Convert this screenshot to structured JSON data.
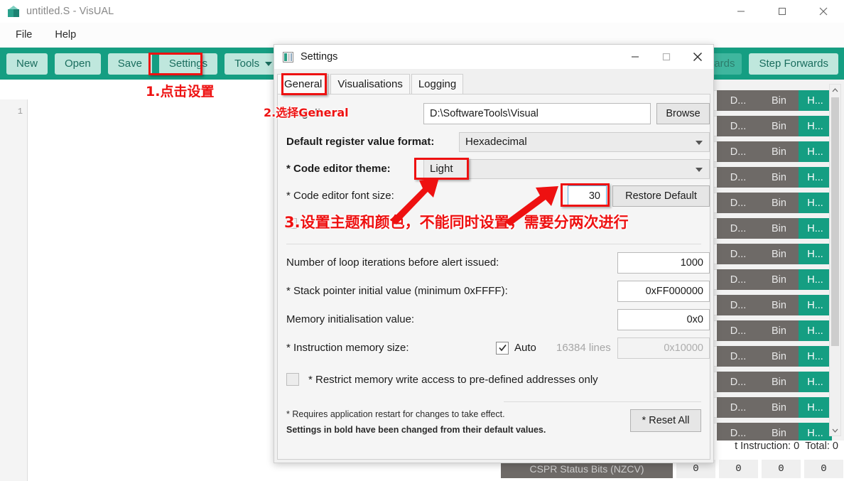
{
  "window": {
    "title": "untitled.S - VisUAL",
    "icon": "cube-icon",
    "controls": {
      "minimize": "minimize-icon",
      "maximize": "maximize-icon",
      "close": "close-icon"
    }
  },
  "menubar": {
    "items": [
      "File",
      "Help"
    ]
  },
  "toolbar": {
    "buttons": [
      "New",
      "Open",
      "Save",
      "Settings"
    ],
    "tools_label": "Tools",
    "right_buttons": [
      "wards",
      "Step Forwards"
    ],
    "step_backwards_truncated": "wards",
    "step_forwards": "Step Forwards"
  },
  "editor": {
    "line_numbers": [
      "1"
    ],
    "content": ""
  },
  "registers": {
    "row_count": 14,
    "buttons": {
      "dec": "D...",
      "bin": "Bin",
      "hex": "H..."
    },
    "scrollbar": {
      "up": "chevron-up-icon",
      "down": "chevron-down-icon"
    }
  },
  "status": {
    "instruction_text": "t Instruction:",
    "instruction_value": "0",
    "total_label": "Total:",
    "total_value": "0",
    "cspr_label": "CSPR Status Bits (NZCV)",
    "cspr_values": [
      "0",
      "0",
      "0",
      "0"
    ]
  },
  "dialog": {
    "title": "Settings",
    "icon": "settings-window-icon",
    "controls": {
      "minimize": "minimize-icon",
      "maximize": "maximize-icon",
      "close": "close-icon"
    },
    "tabs": [
      {
        "label": "General",
        "active": true
      },
      {
        "label": "Visualisations",
        "active": false
      },
      {
        "label": "Logging",
        "active": false
      }
    ],
    "fields": {
      "working_dir": {
        "label": "king dir...",
        "value": "D:\\SoftwareTools\\Visual",
        "browse": "Browse"
      },
      "register_format": {
        "label": "Default register value format:",
        "value": "Hexadecimal"
      },
      "editor_theme": {
        "label": "* Code editor theme:",
        "value": "Light"
      },
      "editor_font_size": {
        "label": "* Code editor font size:",
        "value": "30",
        "restore": "Restore Default"
      },
      "loop_iterations": {
        "label": "Number of loop iterations before alert issued:",
        "value": "1000"
      },
      "stack_pointer": {
        "label": "* Stack pointer initial value (minimum 0xFFFF):",
        "value": "0xFF000000"
      },
      "memory_init": {
        "label": "Memory initialisation value:",
        "value": "0x0"
      },
      "instruction_memory": {
        "label": "* Instruction memory size:",
        "auto_label": "Auto",
        "auto_checked": true,
        "lines": "16384 lines",
        "value": "0x10000"
      },
      "restrict_memory": {
        "label": "* Restrict memory write access to pre-defined addresses only",
        "checked": false
      }
    },
    "footnotes": {
      "restart": "* Requires application restart for changes to take effect.",
      "bold_note": "Settings in bold have been changed from their default values."
    },
    "reset_all": "* Reset All"
  },
  "annotations": {
    "color": "#ee1111",
    "step1": "1.点击设置",
    "step2": "2.选择General",
    "step3": "3.设置主题和颜色，不能同时设置，需要分两次进行"
  }
}
